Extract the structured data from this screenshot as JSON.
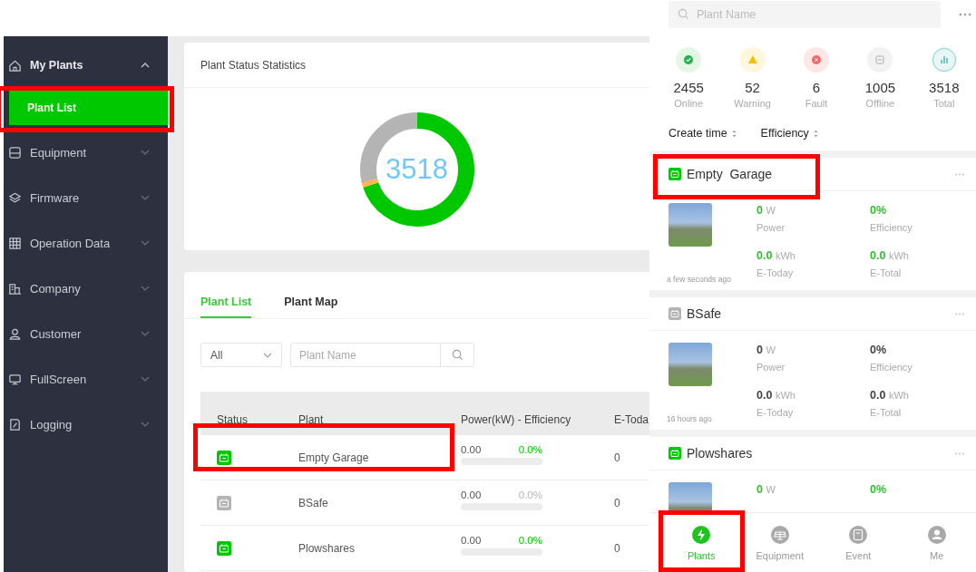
{
  "sidebar": {
    "items": [
      {
        "label": "My Plants",
        "expanded": true,
        "children": [
          {
            "label": "Plant List",
            "selected": true,
            "annotated": true
          }
        ]
      },
      {
        "label": "Equipment",
        "expanded": false
      },
      {
        "label": "Firmware",
        "expanded": false
      },
      {
        "label": "Operation Data",
        "expanded": false
      },
      {
        "label": "Company",
        "expanded": false
      },
      {
        "label": "Customer",
        "expanded": false
      },
      {
        "label": "FullScreen",
        "expanded": false
      },
      {
        "label": "Logging",
        "expanded": false
      }
    ]
  },
  "status_card": {
    "title": "Plant Status Statistics",
    "total": "3518"
  },
  "plant_panel": {
    "tabs": [
      {
        "label": "Plant List",
        "selected": true
      },
      {
        "label": "Plant Map",
        "selected": false
      }
    ],
    "filter": {
      "value": "All"
    },
    "search": {
      "placeholder": "Plant Name"
    },
    "table": {
      "columns": [
        "Status",
        "Plant",
        "Power(kW) - Efficiency",
        "E-Toda"
      ],
      "rows": [
        {
          "color": "#00c800",
          "plant": "Empty Garage",
          "power": "0.00",
          "efficiency": "0.0%",
          "e_today": "0",
          "annotated": true
        },
        {
          "color": "#b4b4b4",
          "plant": "BSafe",
          "power": "0.00",
          "efficiency": "0.0%",
          "e_today": "0",
          "annotated": false
        },
        {
          "color": "#00c800",
          "plant": "Plowshares",
          "power": "0.00",
          "efficiency": "0.0%",
          "e_today": "0",
          "annotated": false
        }
      ]
    }
  },
  "mobile": {
    "search": {
      "placeholder": "Plant Name"
    },
    "stats": [
      {
        "kind": "online",
        "count": "2455",
        "label": "Online"
      },
      {
        "kind": "warning",
        "count": "52",
        "label": "Warning"
      },
      {
        "kind": "fault",
        "count": "6",
        "label": "Fault"
      },
      {
        "kind": "offline",
        "count": "1005",
        "label": "Offline"
      },
      {
        "kind": "total",
        "count": "3518",
        "label": "Total"
      }
    ],
    "sort": [
      {
        "label": "Create time"
      },
      {
        "label": "Efficiency"
      }
    ],
    "plants": [
      {
        "name": "Empty  Garage",
        "color": "#00c800",
        "active": true,
        "annotated": true,
        "updated": "a few seconds ago",
        "metrics": [
          {
            "value": "0",
            "unit": "W",
            "label": "Power"
          },
          {
            "value": "0%",
            "label": "Efficiency"
          },
          {
            "value": "0.0",
            "unit": "kWh",
            "label": "E-Today"
          },
          {
            "value": "0.0",
            "unit": "kWh",
            "label": "E-Total"
          }
        ]
      },
      {
        "name": "BSafe",
        "color": "#b4b4b4",
        "active": false,
        "annotated": false,
        "updated": "16 hours ago",
        "metrics": [
          {
            "value": "0",
            "unit": "W",
            "label": "Power"
          },
          {
            "value": "0%",
            "label": "Efficiency"
          },
          {
            "value": "0.0",
            "unit": "kWh",
            "label": "E-Today"
          },
          {
            "value": "0.0",
            "unit": "kWh",
            "label": "E-Total"
          }
        ]
      },
      {
        "name": "Plowshares",
        "color": "#00c800",
        "active": true,
        "annotated": false,
        "metrics": [
          {
            "value": "0",
            "unit": "W"
          },
          {
            "value": "0%"
          }
        ]
      }
    ],
    "nav": [
      {
        "label": "Plants",
        "selected": true,
        "annotated": true
      },
      {
        "label": "Equipment",
        "selected": false,
        "annotated": false
      },
      {
        "label": "Event",
        "selected": false,
        "annotated": false
      },
      {
        "label": "Me",
        "selected": false,
        "annotated": false
      }
    ]
  }
}
